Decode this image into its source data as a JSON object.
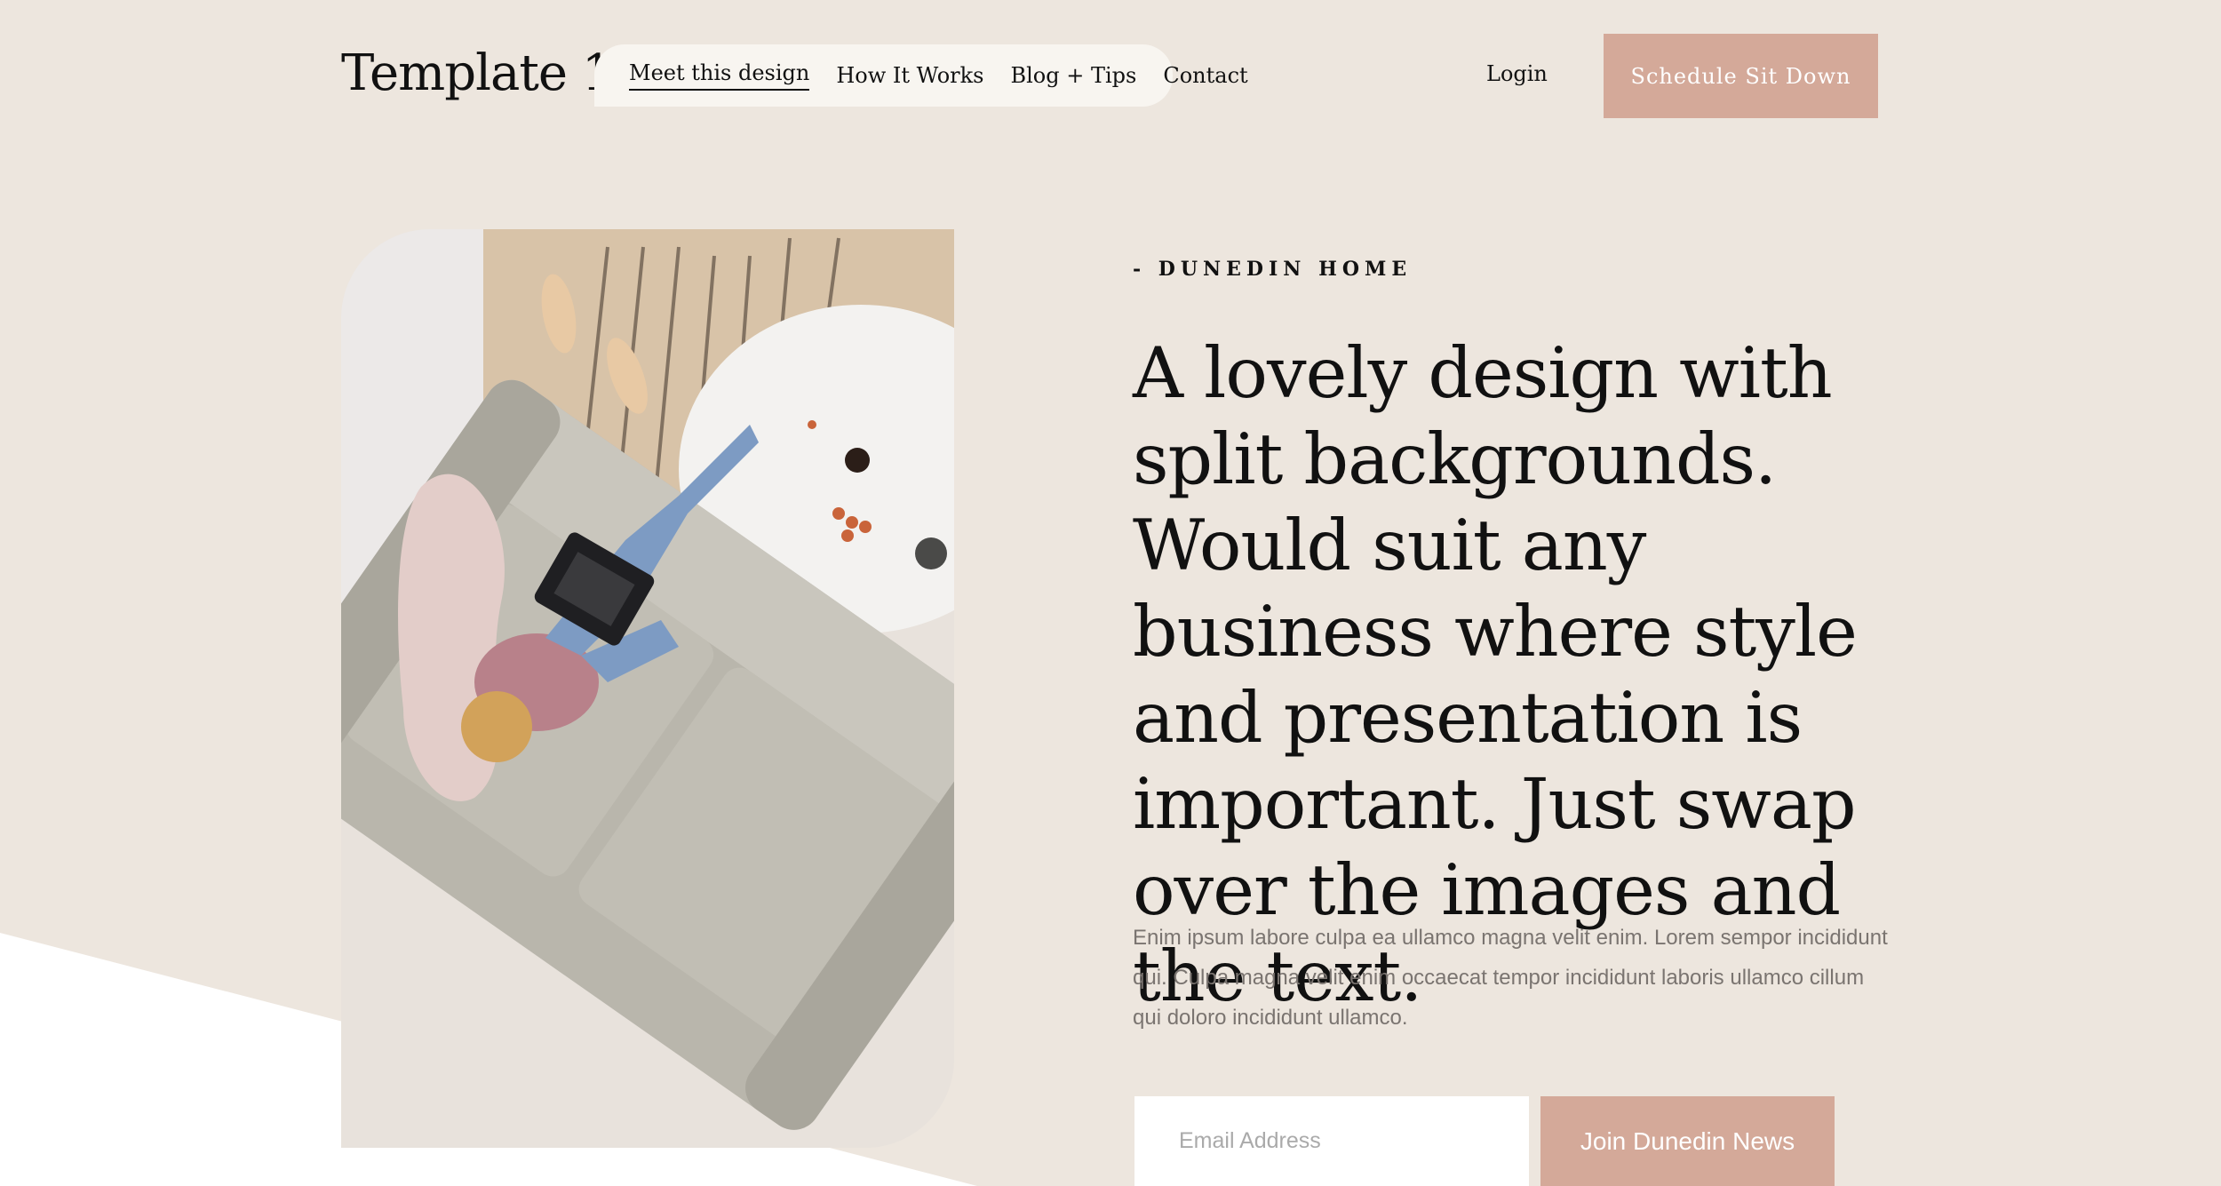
{
  "brand": {
    "logo_text": "Template 19"
  },
  "nav": {
    "items": [
      {
        "label": "Meet this design",
        "active": true
      },
      {
        "label": "How It Works",
        "active": false
      },
      {
        "label": "Blog + Tips",
        "active": false
      },
      {
        "label": "Contact",
        "active": false
      }
    ],
    "login_label": "Login",
    "cta_label": "Schedule Sit Down"
  },
  "hero": {
    "eyebrow": "- DUNEDIN HOME",
    "headline": "A lovely design with split backgrounds. Would suit any business where style and presentation is important. Just swap over the images and the text.",
    "body": "Enim ipsum labore culpa ea ullamco magna velit enim. Lorem sempor incididunt qui. Culpa magna velit enim occaecat tempor incididunt laboris ullamco cillum qui doloro incididunt ullamco.",
    "image_icon": "photo-woman-on-sofa-with-laptop"
  },
  "newsletter": {
    "email_placeholder": "Email Address",
    "button_label": "Join Dunedin News"
  },
  "colors": {
    "background": "#ede6de",
    "accent": "#d4a999",
    "nav_pill": "#f8f5f0",
    "text": "#111111",
    "muted_text": "#7a7470"
  }
}
